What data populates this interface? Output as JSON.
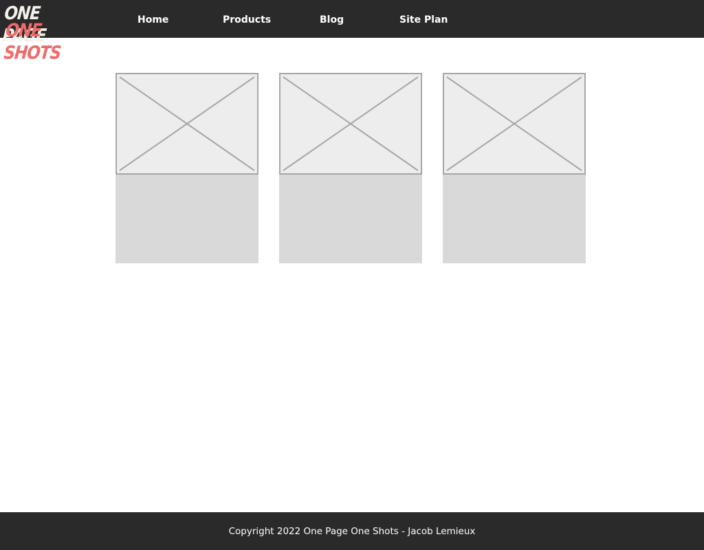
{
  "header": {
    "logo": {
      "line1": "ONE PAGE",
      "line2": "ONE SHOTS"
    },
    "nav": [
      {
        "label": "Home"
      },
      {
        "label": "Products"
      },
      {
        "label": "Blog"
      },
      {
        "label": "Site Plan"
      }
    ]
  },
  "cards": [
    {
      "image_icon": "image-placeholder-icon"
    },
    {
      "image_icon": "image-placeholder-icon"
    },
    {
      "image_icon": "image-placeholder-icon"
    }
  ],
  "footer": {
    "text": "Copyright 2022 One Page One Shots - Jacob Lemieux"
  },
  "colors": {
    "header_bg": "#2a2a2a",
    "footer_bg": "#2a2a2a",
    "logo_primary": "#f4f1ea",
    "logo_accent": "#f06a6a",
    "placeholder_fill": "#ededed",
    "placeholder_stroke": "#a6a6a6",
    "card_body": "#d9d9d9"
  }
}
